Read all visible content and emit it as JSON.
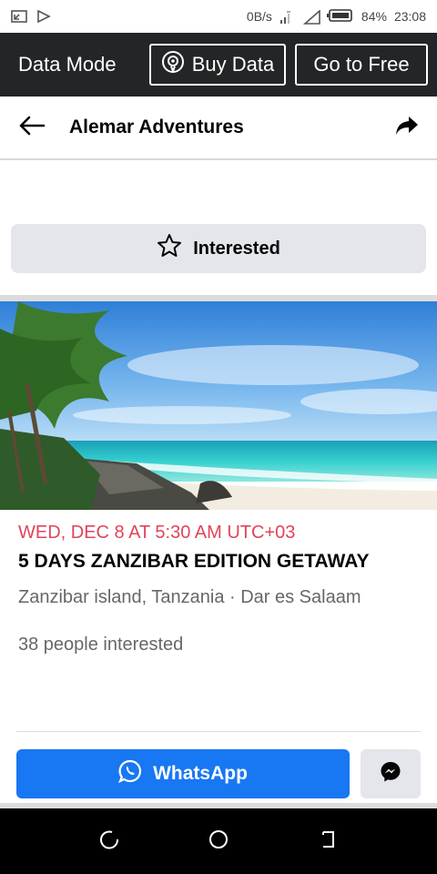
{
  "status_bar": {
    "network_speed": "0B/s",
    "battery": "84%",
    "time": "23:08"
  },
  "data_bar": {
    "title": "Data Mode",
    "buy_label": "Buy Data",
    "free_label": "Go to Free"
  },
  "header": {
    "title": "Alemar Adventures"
  },
  "interested_button": {
    "label": "Interested"
  },
  "event": {
    "date": "WED, DEC 8 AT 5:30 AM UTC+03",
    "title": "5 DAYS ZANZIBAR EDITION GETAWAY",
    "location": "Zanzibar island, Tanzania · Dar es Salaam",
    "interested_count": "38 people interested"
  },
  "actions": {
    "whatsapp_label": "WhatsApp"
  },
  "colors": {
    "accent_blue": "#1877f2",
    "date_red": "#e0445a",
    "data_bar_bg": "#242526"
  }
}
